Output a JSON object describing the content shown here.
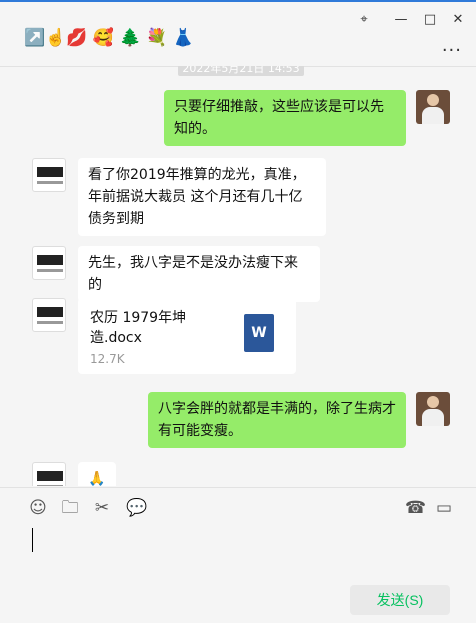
{
  "window": {
    "title": "↗️☝️💋 🥰 🌲 💐 👗",
    "controls": [
      "⌖",
      "—",
      "□",
      "✕"
    ],
    "more": "···"
  },
  "timestamp": "2022年5月21日 14:53",
  "messages": [
    {
      "from": "self",
      "text": "只要仔细推敲，这些应该是可以先知的。"
    },
    {
      "from": "other",
      "text": "看了你2019年推算的龙光，真准，年前据说大裁员 这个月还有几十亿债务到期"
    },
    {
      "from": "other",
      "text": "先生，我八字是不是没办法瘦下来的"
    },
    {
      "from": "other",
      "file": {
        "name": "农历 1979年坤造.docx",
        "size": "12.7K",
        "icon": "W"
      }
    },
    {
      "from": "self",
      "text": "八字会胖的就都是丰满的，除了生病才有可能变瘦。"
    },
    {
      "from": "other",
      "text": "🙏"
    }
  ],
  "toolbar": {
    "emoji": "☺",
    "folder": "🗀",
    "scissors": "✂",
    "chat": "💬",
    "phone": "☎",
    "video": "▭"
  },
  "send_label": "发送(S)",
  "colors": {
    "self_bubble": "#95ec69",
    "other_bubble": "#ffffff",
    "send_text": "#07c160",
    "background": "#f5f5f5"
  }
}
